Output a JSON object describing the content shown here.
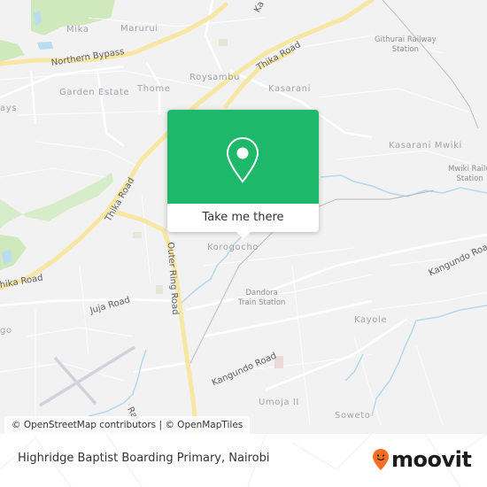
{
  "map": {
    "places": [
      {
        "id": "mika",
        "label": "Mika"
      },
      {
        "id": "marurui",
        "label": "Marurui"
      },
      {
        "id": "roysambu",
        "label": "Roysambu"
      },
      {
        "id": "garden-estate",
        "label": "Garden Estate"
      },
      {
        "id": "thome",
        "label": "Thome"
      },
      {
        "id": "kasarani",
        "label": "Kasarani"
      },
      {
        "id": "kasarani-mwiki",
        "label": "Kasarani Mwiki"
      },
      {
        "id": "korogocho",
        "label": "Korogocho"
      },
      {
        "id": "kayole",
        "label": "Kayole"
      },
      {
        "id": "umoja-ii",
        "label": "Umoja II"
      },
      {
        "id": "soweto",
        "label": "Soweto"
      },
      {
        "id": "ways",
        "label": "ays"
      },
      {
        "id": "go",
        "label": "go"
      }
    ],
    "stations": [
      {
        "id": "githurai",
        "line1": "Githurai Railway",
        "line2": "Station"
      },
      {
        "id": "mwiki",
        "line1": "Mwiki Railw",
        "line2": "Station"
      },
      {
        "id": "dandora",
        "line1": "Dandora",
        "line2": "Train Station"
      }
    ],
    "roads": [
      {
        "id": "northern-bypass",
        "label": "Northern Bypass"
      },
      {
        "id": "thika-road-ne",
        "label": "Thika Road"
      },
      {
        "id": "thika-road-mid",
        "label": "Thika Road"
      },
      {
        "id": "thika-road-sw",
        "label": "hika Road"
      },
      {
        "id": "outer-ring-road",
        "label": "Outer Ring Road"
      },
      {
        "id": "juja-road",
        "label": "Juja Road"
      },
      {
        "id": "kangundo-road-e",
        "label": "Kangundo Road"
      },
      {
        "id": "kangundo-road-s",
        "label": "Kangundo Road"
      },
      {
        "id": "rabai",
        "label": "Raba"
      },
      {
        "id": "kasarani-road-top",
        "label": "Ka"
      }
    ],
    "colors": {
      "land": "#f2f2f2",
      "major_road": "#f7e7a3",
      "park": "#c9e8b5",
      "water": "#b9dcf0",
      "popup_green": "#1eb86a",
      "brand_orange": "#f36f21"
    }
  },
  "popup": {
    "icon": "location-pin-icon",
    "cta_label": "Take me there"
  },
  "attribution": "© OpenStreetMap contributors | © OpenMapTiles",
  "footer": {
    "title": "Highridge Baptist Boarding Primary, Nairobi",
    "brand": "moovit"
  }
}
